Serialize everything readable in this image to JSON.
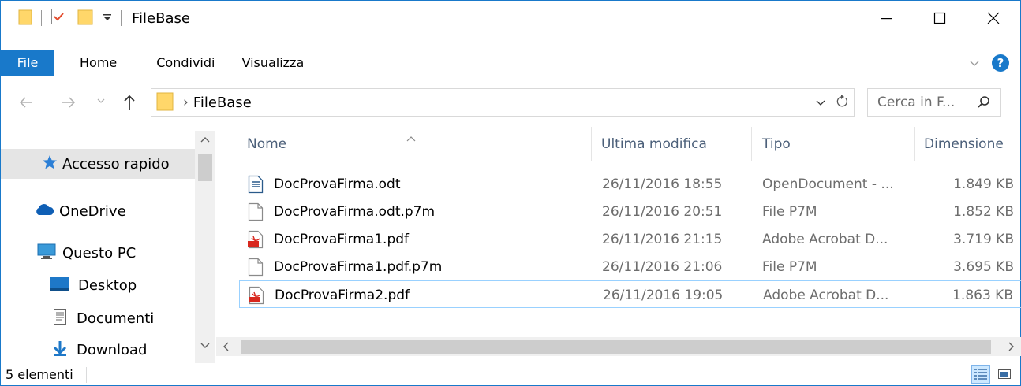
{
  "window": {
    "title": "FileBase"
  },
  "ribbon": {
    "tabs": [
      "File",
      "Home",
      "Condividi",
      "Visualizza"
    ],
    "help_label": "?"
  },
  "address": {
    "path": "FileBase",
    "separator": "›",
    "search_placeholder": "Cerca in F..."
  },
  "nav_pane": {
    "items": [
      {
        "label": "Accesso rapido",
        "icon": "star-icon",
        "selected": true
      },
      {
        "label": "OneDrive",
        "icon": "cloud-icon",
        "selected": false
      },
      {
        "label": "Questo PC",
        "icon": "computer-icon",
        "selected": false
      },
      {
        "label": "Desktop",
        "icon": "desktop-icon",
        "selected": false
      },
      {
        "label": "Documenti",
        "icon": "document-icon",
        "selected": false
      },
      {
        "label": "Download",
        "icon": "download-icon",
        "selected": false
      }
    ]
  },
  "file_list": {
    "columns": [
      "Nome",
      "Ultima modifica",
      "Tipo",
      "Dimensione"
    ],
    "sorted_by": "Nome",
    "files": [
      {
        "name": "DocProvaFirma.odt",
        "modified": "26/11/2016 18:55",
        "type": "OpenDocument - ...",
        "size": "1.849 KB",
        "icon": "odt-icon",
        "selected": false
      },
      {
        "name": "DocProvaFirma.odt.p7m",
        "modified": "26/11/2016 20:51",
        "type": "File P7M",
        "size": "1.852 KB",
        "icon": "blank-file-icon",
        "selected": false
      },
      {
        "name": "DocProvaFirma1.pdf",
        "modified": "26/11/2016 21:15",
        "type": "Adobe Acrobat D...",
        "size": "3.719 KB",
        "icon": "pdf-icon",
        "selected": false
      },
      {
        "name": "DocProvaFirma1.pdf.p7m",
        "modified": "26/11/2016 21:06",
        "type": "File P7M",
        "size": "3.695 KB",
        "icon": "blank-file-icon",
        "selected": false
      },
      {
        "name": "DocProvaFirma2.pdf",
        "modified": "26/11/2016 19:05",
        "type": "Adobe Acrobat D...",
        "size": "1.863 KB",
        "icon": "pdf-icon",
        "selected": true
      }
    ]
  },
  "status": {
    "item_count": "5 elementi"
  },
  "colors": {
    "accent": "#1979ca",
    "folder": "#ffd76a",
    "selection": "#cce8ff",
    "pdf_red": "#d8281e"
  }
}
